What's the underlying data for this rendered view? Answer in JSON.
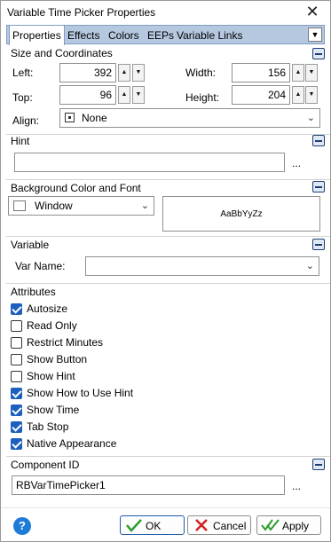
{
  "window": {
    "title": "Variable Time Picker Properties"
  },
  "tabs": [
    "Properties",
    "Effects",
    "Colors",
    "EEPs",
    "Variable Links"
  ],
  "size_coords": {
    "title": "Size and Coordinates",
    "left_label": "Left:",
    "left_value": "392",
    "top_label": "Top:",
    "top_value": "96",
    "width_label": "Width:",
    "width_value": "156",
    "height_label": "Height:",
    "height_value": "204",
    "align_label": "Align:",
    "align_value": "None"
  },
  "hint": {
    "title": "Hint",
    "value": "",
    "ellipsis": "..."
  },
  "background": {
    "title": "Background Color and Font",
    "color_value": "Window",
    "preview_text": "AaBbYyZz"
  },
  "variable": {
    "title": "Variable",
    "var_name_label": "Var Name:",
    "var_name_value": ""
  },
  "attributes": {
    "title": "Attributes",
    "items": [
      {
        "label": "Autosize",
        "checked": true
      },
      {
        "label": "Read Only",
        "checked": false
      },
      {
        "label": "Restrict Minutes",
        "checked": false
      },
      {
        "label": "Show Button",
        "checked": false
      },
      {
        "label": "Show Hint",
        "checked": false
      },
      {
        "label": "Show How to Use Hint",
        "checked": true
      },
      {
        "label": "Show Time",
        "checked": true
      },
      {
        "label": "Tab Stop",
        "checked": true
      },
      {
        "label": "Native Appearance",
        "checked": true
      }
    ]
  },
  "component": {
    "title": "Component ID",
    "value": "RBVarTimePicker1",
    "ellipsis": "..."
  },
  "footer": {
    "help": "?",
    "ok": "OK",
    "cancel": "Cancel",
    "apply": "Apply"
  },
  "colors": {
    "tab_bar": "#b6c8e0",
    "accent": "#1c5fbd",
    "ok_check": "#2a9d2a",
    "cancel_x": "#d32020"
  }
}
